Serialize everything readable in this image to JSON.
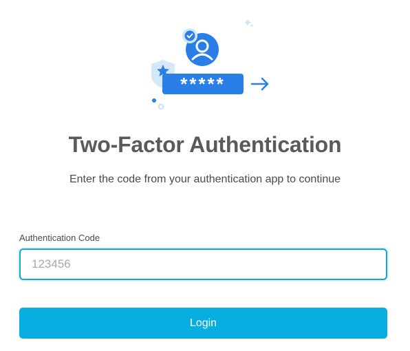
{
  "page": {
    "title": "Two-Factor Authentication",
    "subtitle": "Enter the code from your authentication app to continue"
  },
  "form": {
    "code_label": "Authentication Code",
    "code_placeholder": "123456",
    "code_value": "",
    "login_label": "Login"
  },
  "illustration": {
    "password_mask": "*****",
    "icons": [
      "user-avatar-icon",
      "check-badge-icon",
      "star-shield-icon",
      "arrow-right-icon",
      "sparkle-icon"
    ]
  },
  "colors": {
    "accent": "#08ade2",
    "illustration_blue": "#2a7ee8",
    "title_text": "#5a5a5a",
    "body_text": "#4a4a4a"
  }
}
